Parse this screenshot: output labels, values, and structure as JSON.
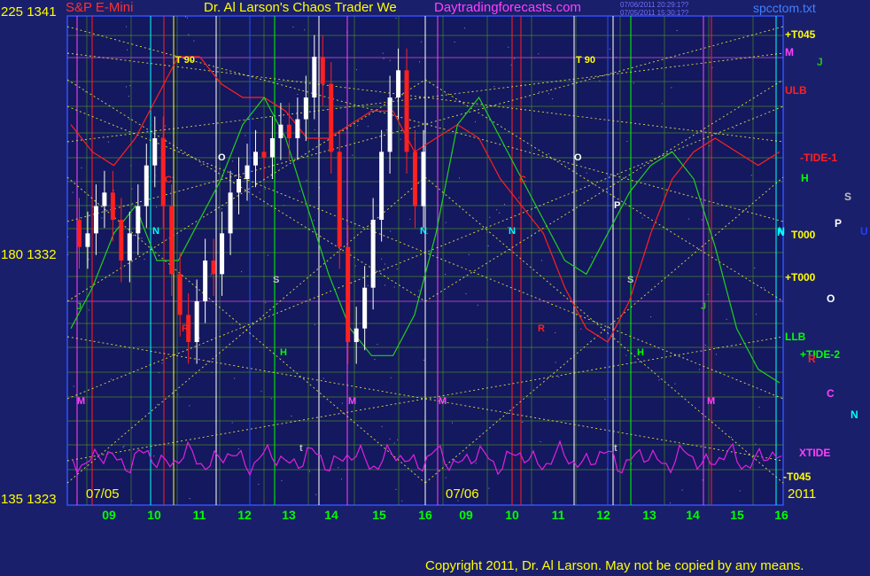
{
  "header": {
    "instrument": "S&P E-Mini",
    "title": "Dr. Al Larson's Chaos Trader We",
    "site": "Daytradingforecasts.com",
    "stamp_line1": "07/06/2011 20:29:1??",
    "stamp_line2": "07/05/2011 15:30:1??",
    "file": "spcctom.txt"
  },
  "footer": {
    "copyright": "Copyright 2011, Dr. Al Larson. May not be copied by any means."
  },
  "left_axis": [
    {
      "label": "225  1341"
    },
    {
      "label": "180  1332"
    },
    {
      "label": "135  1323"
    }
  ],
  "right_labels": [
    {
      "text": "+T045",
      "color": "#ffff00"
    },
    {
      "text": "M",
      "color": "#ff40ff"
    },
    {
      "text": "J",
      "color": "#20c020"
    },
    {
      "text": "ULB",
      "color": "#ff2020"
    },
    {
      "text": "-TIDE-1",
      "color": "#ff2020"
    },
    {
      "text": "H",
      "color": "#00ff00"
    },
    {
      "text": "S",
      "color": "#c0c0c0"
    },
    {
      "text": "P",
      "color": "#ffffff"
    },
    {
      "text": "U",
      "color": "#2040ff"
    },
    {
      "text": "N",
      "color": "#00ffff"
    },
    {
      "text": "T000",
      "color": "#ffff00"
    },
    {
      "text": "+T000",
      "color": "#ffff00"
    },
    {
      "text": "O",
      "color": "#ffffff"
    },
    {
      "text": "LLB",
      "color": "#00ff00"
    },
    {
      "text": "+TIDE-2",
      "color": "#00ff00"
    },
    {
      "text": "R",
      "color": "#ff2020"
    },
    {
      "text": "C",
      "color": "#ff40ff"
    },
    {
      "text": "N",
      "color": "#00ffff"
    },
    {
      "text": "XTIDE",
      "color": "#ff40ff"
    },
    {
      "text": "-T045",
      "color": "#ffff00"
    }
  ],
  "date_labels": [
    {
      "text": "07/05"
    },
    {
      "text": "07/06"
    },
    {
      "text": "2011"
    }
  ],
  "plot_labels": [
    {
      "text": "T  90",
      "color": "#ffff00"
    },
    {
      "text": "T  90",
      "color": "#ffff00"
    },
    {
      "text": "O",
      "color": "#ffffff"
    },
    {
      "text": "O",
      "color": "#ffffff"
    },
    {
      "text": "C",
      "color": "#ff2020"
    },
    {
      "text": "C",
      "color": "#ff2020"
    },
    {
      "text": "P",
      "color": "#ffffff"
    },
    {
      "text": "N",
      "color": "#00ffff"
    },
    {
      "text": "N",
      "color": "#00ffff"
    },
    {
      "text": "N",
      "color": "#00ffff"
    },
    {
      "text": "N",
      "color": "#00ffff"
    },
    {
      "text": "S",
      "color": "#c0c0c0"
    },
    {
      "text": "S",
      "color": "#c0c0c0"
    },
    {
      "text": "H",
      "color": "#00ff00"
    },
    {
      "text": "H",
      "color": "#00ff00"
    },
    {
      "text": "R",
      "color": "#ff2020"
    },
    {
      "text": "R",
      "color": "#ff2020"
    },
    {
      "text": "M",
      "color": "#ff40ff"
    },
    {
      "text": "M",
      "color": "#ff40ff"
    },
    {
      "text": "M",
      "color": "#ff40ff"
    },
    {
      "text": "M",
      "color": "#ff40ff"
    },
    {
      "text": "t",
      "color": "#c0c0c0"
    },
    {
      "text": "t",
      "color": "#c0c0c0"
    },
    {
      "text": "J",
      "color": "#20c020"
    },
    {
      "text": "J",
      "color": "#20c020"
    }
  ],
  "chart_data": {
    "type": "line",
    "title": "S&P E-Mini",
    "y_right_scale": [
      1323,
      1332,
      1341
    ],
    "y_left_scale": [
      135,
      180,
      225
    ],
    "x_ticks": [
      "09",
      "10",
      "11",
      "12",
      "13",
      "14",
      "15",
      "16",
      "09",
      "10",
      "11",
      "12",
      "13",
      "14",
      "15",
      "16"
    ],
    "sessions": [
      "07/05",
      "07/06"
    ],
    "series": [
      {
        "name": "S&P E-Mini",
        "color": "#ffffff",
        "values": [
          1333.5,
          1332.5,
          1333.0,
          1334.0,
          1334.5,
          1333.5,
          1332.0,
          1333.0,
          1334.0,
          1335.5,
          1336.5,
          1334.0,
          1331.5,
          1330.0,
          1329.0,
          1330.5,
          1332.0,
          1331.5,
          1333.0,
          1334.5,
          1335.0,
          1335.5,
          1336.0,
          1335.8,
          1336.5,
          1337.0,
          1336.5,
          1337.2,
          1338.0,
          1339.5,
          1338.5,
          1336.0,
          1332.5,
          1329.0,
          1329.5,
          1331.0,
          1333.5,
          1336.0,
          1338.0,
          1339.0,
          1336.0,
          1334.0,
          1336.0
        ]
      },
      {
        "name": "ULB",
        "color": "#ff2020",
        "values": [
          1337.0,
          1336.0,
          1335.5,
          1336.5,
          1338.0,
          1339.5,
          1339.5,
          1338.5,
          1338.0,
          1338.0,
          1337.5,
          1336.5,
          1336.5,
          1337.0,
          1337.5,
          1337.5,
          1336.0,
          1336.5,
          1337.0,
          1336.5,
          1335.0,
          1334.0,
          1333.0,
          1331.0,
          1329.5,
          1329.0,
          1330.5,
          1333.0,
          1335.0,
          1336.0,
          1336.5,
          1336.0,
          1335.5,
          1336.0
        ]
      },
      {
        "name": "LLB",
        "color": "#20d020",
        "values": [
          1329.5,
          1331.0,
          1333.0,
          1334.0,
          1332.0,
          1332.0,
          1333.5,
          1335.0,
          1337.0,
          1338.0,
          1336.5,
          1334.0,
          1331.5,
          1329.5,
          1328.5,
          1328.5,
          1330.0,
          1333.0,
          1337.0,
          1338.0,
          1336.5,
          1335.0,
          1333.5,
          1332.0,
          1331.5,
          1333.0,
          1334.5,
          1335.5,
          1336.0,
          1335.0,
          1332.5,
          1329.5,
          1328.0,
          1327.5
        ]
      },
      {
        "name": "XTIDE",
        "color": "#e020e0"
      }
    ]
  }
}
